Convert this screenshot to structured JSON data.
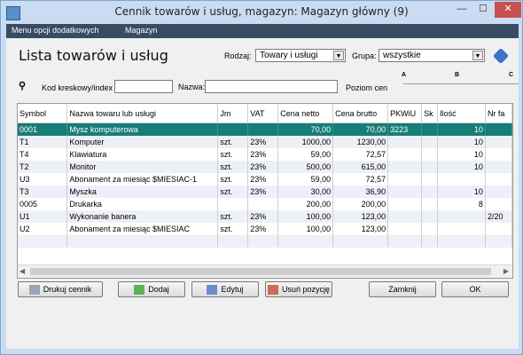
{
  "window": {
    "title": "Cennik towarów i usług, magazyn: Magazyn główny (9)",
    "min": "—",
    "max": "☐",
    "close": "✕"
  },
  "menu": [
    "Menu opcji dodatkowych",
    "Magazyn"
  ],
  "heading": "Lista towarów i usług",
  "filters": {
    "rodzaj_label": "Rodzaj:",
    "rodzaj_value": "Towary i usługi",
    "grupa_label": "Grupa:",
    "grupa_value": "wszystkie"
  },
  "search": {
    "barcode_label": "Kod kreskowy/index",
    "barcode_value": "",
    "name_label": "Nazwa:",
    "name_value": "",
    "price_level_label": "Poziom cen",
    "price_levels": [
      "A",
      "B",
      "C"
    ]
  },
  "table": {
    "columns": [
      "Symbol",
      "Nazwa towaru lub usługi",
      "Jm",
      "VAT",
      "Cena netto",
      "Cena brutto",
      "PKWiU",
      "Sk",
      "Ilość",
      "Nr fa"
    ],
    "rows": [
      [
        "0001",
        "Mysz komputerowa",
        "",
        "",
        "70,00",
        "70,00",
        "3223",
        "",
        "10",
        ""
      ],
      [
        "T1",
        "Komputer",
        "szt.",
        "23%",
        "1000,00",
        "1230,00",
        "",
        "",
        "10",
        ""
      ],
      [
        "T4",
        "Klawiatura",
        "szt.",
        "23%",
        "59,00",
        "72,57",
        "",
        "",
        "10",
        ""
      ],
      [
        "T2",
        "Monitor",
        "szt.",
        "23%",
        "500,00",
        "615,00",
        "",
        "",
        "10",
        ""
      ],
      [
        "U3",
        "Abonament za miesiąc $MIESIAC-1",
        "szt.",
        "23%",
        "59,00",
        "72,57",
        "",
        "",
        "",
        ""
      ],
      [
        "T3",
        "Myszka",
        "szt.",
        "23%",
        "30,00",
        "36,90",
        "",
        "",
        "10",
        ""
      ],
      [
        "0005",
        "Drukarka",
        "",
        "",
        "200,00",
        "200,00",
        "",
        "",
        "8",
        ""
      ],
      [
        "U1",
        "Wykonanie banera",
        "szt.",
        "23%",
        "100,00",
        "123,00",
        "",
        "",
        "",
        "2/20"
      ],
      [
        "U2",
        "Abonament za miesiąc $MIESIAC",
        "szt.",
        "23%",
        "100,00",
        "123,00",
        "",
        "",
        "",
        ""
      ]
    ],
    "selected_row": 0
  },
  "buttons": {
    "print": "Drukuj cennik",
    "add": "Dodaj",
    "edit": "Edytuj",
    "delete": "Usuń pozycję",
    "close": "Zamknij",
    "ok": "OK"
  },
  "colors": {
    "selection": "#177e77",
    "menubar": "#384b63",
    "titlebar": "#c9dcf2"
  }
}
